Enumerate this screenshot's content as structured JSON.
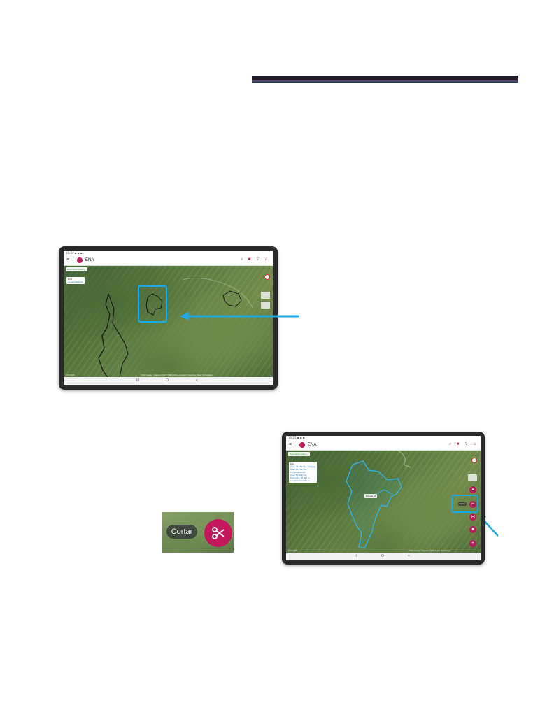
{
  "app": {
    "title": "ENA",
    "menu_icon": "menu-icon",
    "logo_icon": "app-logo-icon",
    "accent_color": "#b31b5a",
    "highlight_color": "#1ea7e1"
  },
  "tablet1": {
    "status_text": "10:24 ▪ ▪ ▪",
    "map_chip": "Desmarcar todas ▪ ▪",
    "info_lines": [
      "ENA",
      "Longitud/latitude"
    ],
    "google_label": "Google",
    "attribution": "©2022 Google · Imágenes ©2022 CNES / Airbus, Landsat / Copernicus, Maxar Technologies",
    "nav": [
      "III",
      "O",
      "<"
    ]
  },
  "tablet2": {
    "status_text": "10:25 ▪ ▪ ▪",
    "map_chip": "Desmarcar todas ▪ ▪",
    "info_lines": [
      "ENA",
      "Área: 25.2647 ha · Original",
      "Área: 25.2647 ha",
      "Longitud/latitude",
      "Área: 56.3037 ha",
      "Perímetro: 28.360 m",
      "Longitud: 18.0070 m"
    ],
    "parcel_label": "Parcela 01",
    "fab_label": "Cortar",
    "google_label": "Google",
    "attribution": "©2022 Google · Imágenes ©2022 Maxar Technologies",
    "nav": [
      "III",
      "O",
      "<"
    ]
  },
  "zoom": {
    "label": "Cortar",
    "icon": "scissors-icon"
  }
}
